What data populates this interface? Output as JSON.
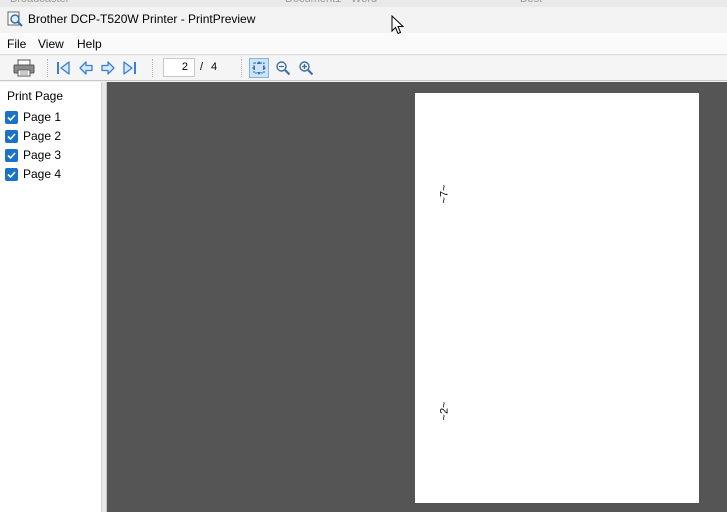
{
  "window": {
    "title": "Brother DCP-T520W Printer - PrintPreview"
  },
  "menu": [
    {
      "label": "File"
    },
    {
      "label": "View"
    },
    {
      "label": "Help"
    }
  ],
  "toolbar": {
    "current_page": "2",
    "separator": "/",
    "total_pages": "4"
  },
  "panel": {
    "title": "Print Page",
    "pages": [
      {
        "label": "Page 1",
        "checked": true
      },
      {
        "label": "Page 2",
        "checked": true
      },
      {
        "label": "Page 3",
        "checked": true
      },
      {
        "label": "Page 4",
        "checked": true
      }
    ]
  },
  "preview": {
    "marks": [
      "~7~",
      "~2~"
    ]
  },
  "colors": {
    "preview_bg": "#555555",
    "checkbox": "#1a73c8",
    "nav_arrow": "#3a7fd5"
  }
}
